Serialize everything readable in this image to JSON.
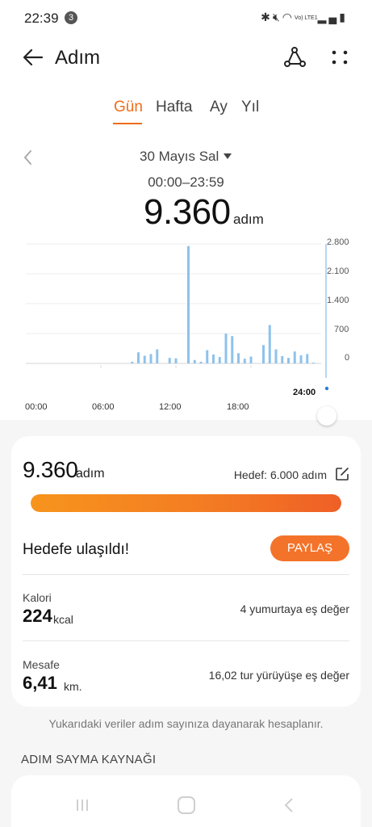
{
  "status_bar": {
    "time": "22:39",
    "notification_count": "3",
    "network_label": "Vo) LTE1"
  },
  "app_bar": {
    "title": "Adım"
  },
  "tabs": [
    {
      "label": "Gün",
      "active": true
    },
    {
      "label": "Hafta",
      "active": false
    },
    {
      "label": "Ay",
      "active": false
    },
    {
      "label": "Yıl",
      "active": false
    }
  ],
  "day": {
    "date": "30 Mayıs Sal",
    "range": "00:00–23:59",
    "steps": "9.360",
    "unit": "adım"
  },
  "chart_data": {
    "type": "bar",
    "x_unit": "hour",
    "xlim": [
      0,
      24
    ],
    "ylim": [
      0,
      2800
    ],
    "yticks": [
      "2.800",
      "2.100",
      "1.400",
      "700",
      "0"
    ],
    "ytick_values": [
      2800,
      2100,
      1400,
      700,
      0
    ],
    "xticks": [
      "00:00",
      "06:00",
      "12:00",
      "18:00"
    ],
    "xtick_values": [
      0,
      6,
      12,
      18
    ],
    "end_label": "24:00",
    "color": "#8ec2ec",
    "hours": [
      8.5,
      9,
      9.5,
      10,
      10.5,
      11.5,
      12,
      13,
      13.5,
      14,
      14.5,
      15,
      15.5,
      16,
      16.5,
      17,
      17.5,
      18,
      19,
      19.5,
      20,
      20.5,
      21,
      21.5,
      22,
      22.5,
      23
    ],
    "values": [
      40,
      260,
      180,
      220,
      330,
      130,
      120,
      2750,
      80,
      40,
      310,
      210,
      150,
      700,
      640,
      240,
      110,
      160,
      430,
      900,
      330,
      170,
      130,
      280,
      190,
      220,
      20
    ]
  },
  "summary": {
    "steps": "9.360",
    "unit": "adım",
    "goal": "Hedef: 6.000 adım",
    "progress": 1.0,
    "reached_text": "Hedefe ulaşıldı!",
    "share_label": "PAYLAŞ"
  },
  "stats": {
    "calories": {
      "label": "Kalori",
      "value": "224",
      "unit": "kcal",
      "equivalent": "4 yumurtaya eş değer"
    },
    "distance": {
      "label": "Mesafe",
      "value": "6,41",
      "unit": "km.",
      "equivalent": "16,02 tur yürüyüşe eş değer"
    }
  },
  "note": "Yukarıdaki veriler adım sayınıza dayanarak hesaplanır.",
  "section_title": "ADIM SAYMA KAYNAĞI"
}
